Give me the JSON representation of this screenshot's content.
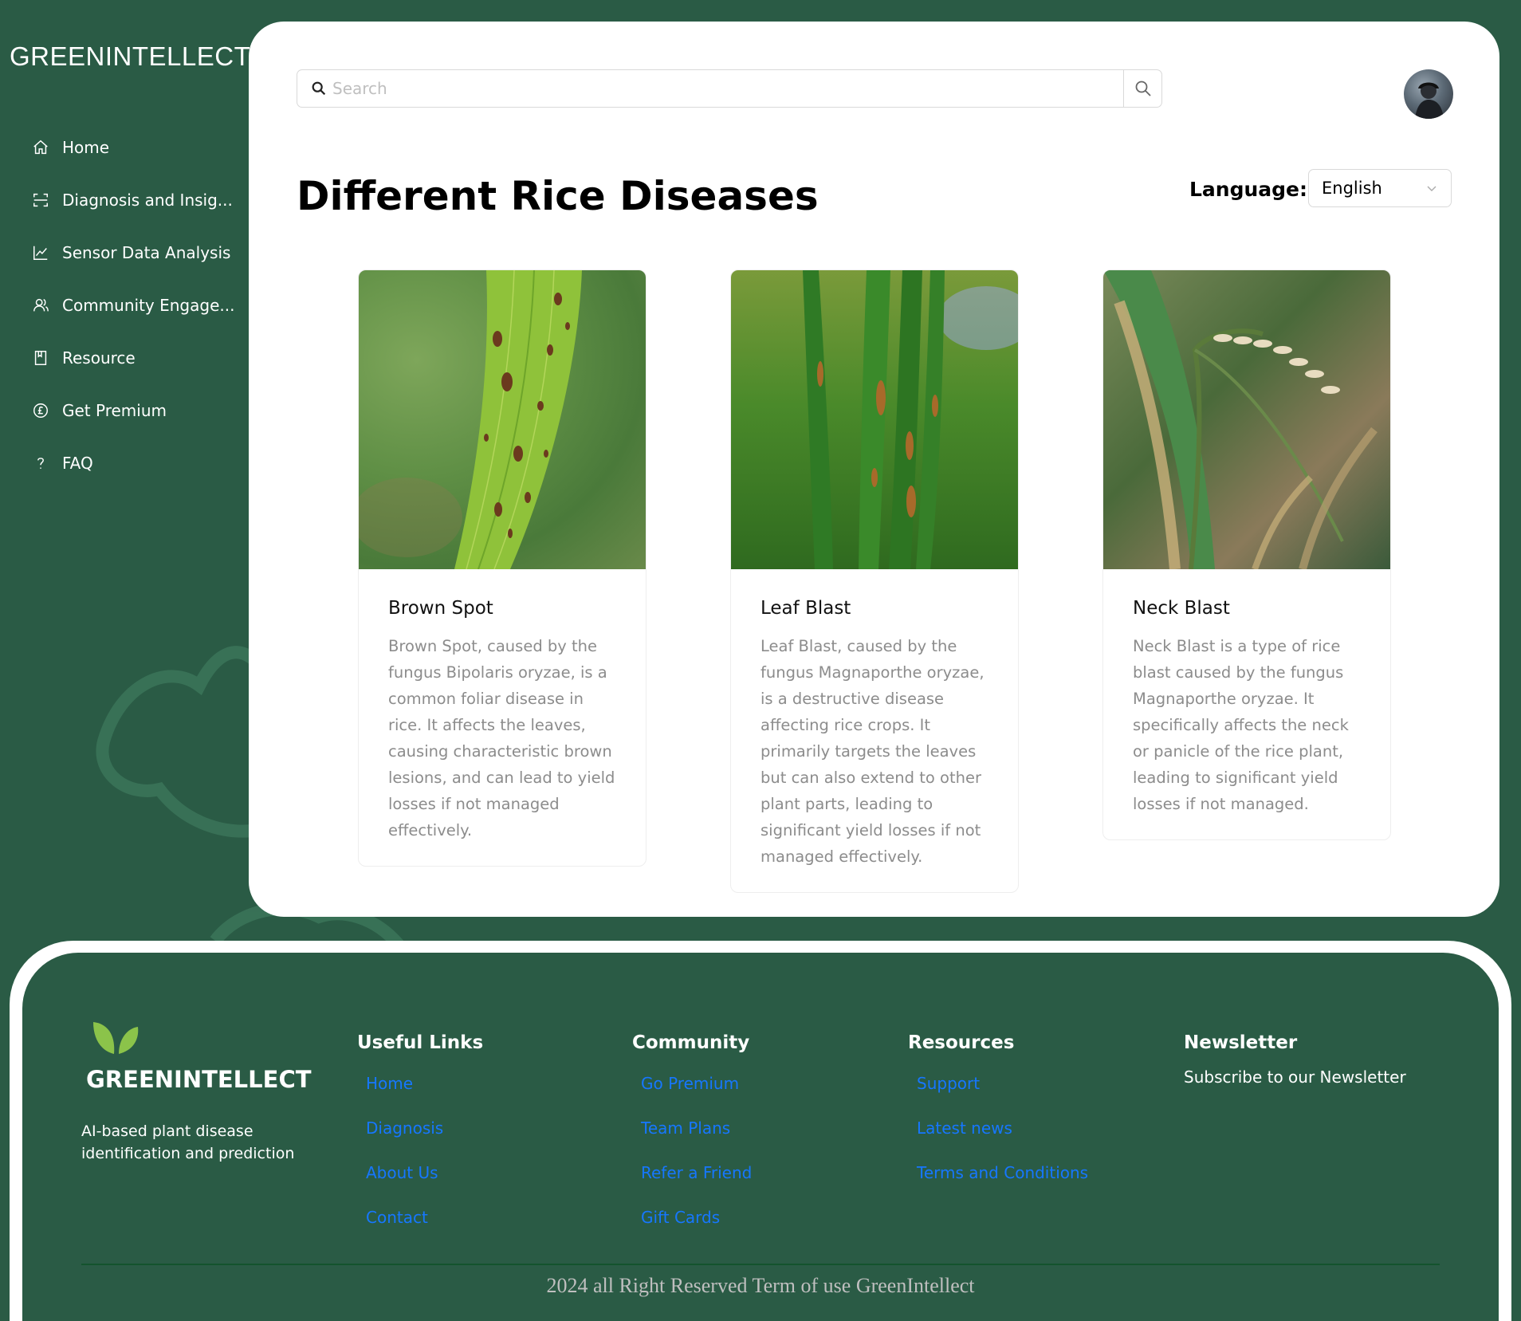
{
  "sidebar": {
    "brand": "GREENINTELLECT",
    "items": [
      {
        "label": "Home",
        "icon": "home-icon"
      },
      {
        "label": "Diagnosis and Insig...",
        "icon": "scan-icon"
      },
      {
        "label": "Sensor Data Analysis",
        "icon": "line-chart-icon"
      },
      {
        "label": "Community Engage...",
        "icon": "users-icon"
      },
      {
        "label": "Resource",
        "icon": "book-icon"
      },
      {
        "label": "Get Premium",
        "icon": "pound-circle-icon"
      },
      {
        "label": "FAQ",
        "icon": "question-icon"
      }
    ]
  },
  "header": {
    "search_placeholder": "Search"
  },
  "main": {
    "title": "Different Rice Diseases",
    "language_label": "Language:",
    "language_value": "English",
    "cards": [
      {
        "title": "Brown Spot",
        "description": "Brown Spot, caused by the fungus Bipolaris oryzae, is a common foliar disease in rice. It affects the leaves, causing characteristic brown lesions, and can lead to yield losses if not managed effectively."
      },
      {
        "title": "Leaf Blast",
        "description": "Leaf Blast, caused by the fungus Magnaporthe oryzae, is a destructive disease affecting rice crops. It primarily targets the leaves but can also extend to other plant parts, leading to significant yield losses if not managed effectively."
      },
      {
        "title": "Neck Blast",
        "description": "Neck Blast is a type of rice blast caused by the fungus Magnaporthe oryzae. It specifically affects the neck or panicle of the rice plant, leading to significant yield losses if not managed."
      }
    ]
  },
  "footer": {
    "brand": "GREENINTELLECT",
    "tagline": "AI-based plant disease identification and prediction",
    "columns": [
      {
        "title": "Useful Links",
        "links": [
          "Home",
          "Diagnosis",
          "About Us",
          "Contact"
        ]
      },
      {
        "title": "Community",
        "links": [
          "Go Premium",
          "Team Plans",
          "Refer a Friend",
          "Gift Cards"
        ]
      },
      {
        "title": "Resources",
        "links": [
          "Support",
          "Latest news",
          "Terms and Conditions"
        ]
      }
    ],
    "newsletter": {
      "title": "Newsletter",
      "text": "Subscribe to our Newsletter"
    },
    "copyright": "2024 all Right Reserved Term of use GreenIntellect"
  },
  "colors": {
    "background": "#2a5b45",
    "link": "#1677ff",
    "card_text": "#8c8c8c"
  }
}
